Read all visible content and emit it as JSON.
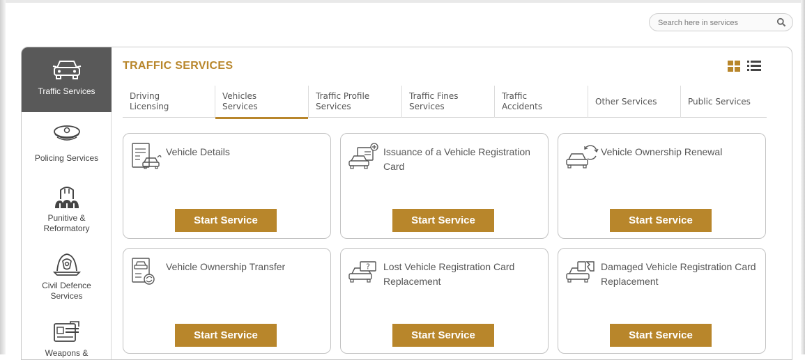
{
  "search": {
    "placeholder": "Search here in services",
    "icon": "search-icon"
  },
  "brand_color": "#b8862b",
  "sidebar": {
    "items": [
      {
        "label": "Traffic Services",
        "icon": "car-icon",
        "active": true
      },
      {
        "label": "Policing Services",
        "icon": "police-cap-icon"
      },
      {
        "label": "Punitive & Reformatory",
        "icon": "prison-icon"
      },
      {
        "label": "Civil Defence Services",
        "icon": "firefighter-helmet-icon"
      },
      {
        "label": "Weapons &",
        "icon": "id-card-icon"
      }
    ]
  },
  "main": {
    "title": "TRAFFIC SERVICES",
    "view_icons": [
      "grid-view-icon",
      "list-view-icon"
    ],
    "tabs": [
      {
        "label": "Driving Licensing"
      },
      {
        "label": "Vehicles Services",
        "active": true
      },
      {
        "label": "Traffic Profile Services"
      },
      {
        "label": "Traffic Fines Services"
      },
      {
        "label": "Traffic Accidents"
      },
      {
        "label": "Other Services"
      },
      {
        "label": "Public Services"
      }
    ],
    "cards": [
      {
        "name": "Vehicle Details",
        "icon": "vehicle-document-icon",
        "button": "Start Service"
      },
      {
        "name": "Issuance of a Vehicle Registration Card",
        "icon": "car-card-add-icon",
        "button": "Start Service"
      },
      {
        "name": "Vehicle Ownership Renewal",
        "icon": "car-renew-icon",
        "button": "Start Service"
      },
      {
        "name": "Vehicle Ownership Transfer",
        "icon": "car-transfer-icon",
        "button": "Start Service"
      },
      {
        "name": "Lost Vehicle Registration Card Replacement",
        "icon": "car-card-question-icon",
        "button": "Start Service"
      },
      {
        "name": "Damaged Vehicle Registration Card Replacement",
        "icon": "car-card-damaged-icon",
        "button": "Start Service"
      }
    ]
  }
}
